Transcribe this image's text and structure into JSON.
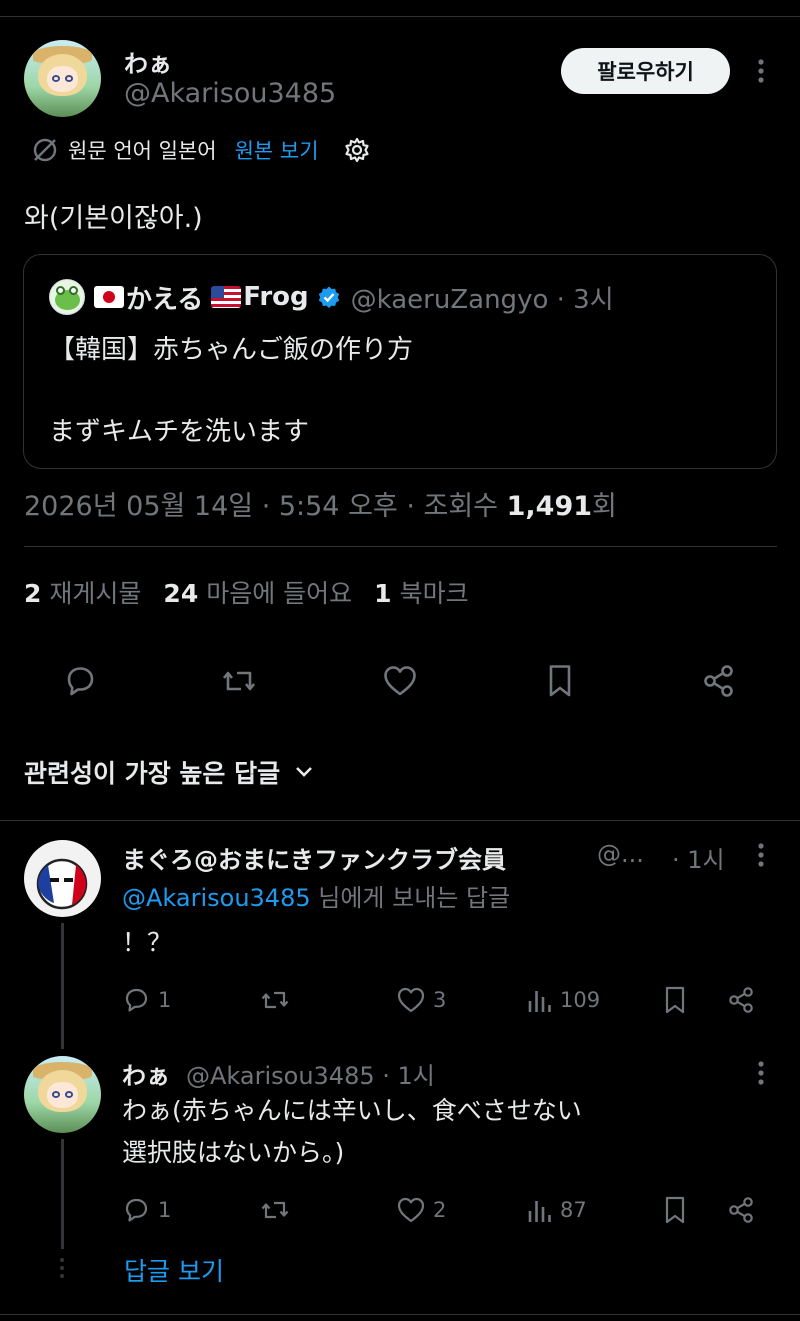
{
  "post": {
    "author_name": "わぁ",
    "author_handle": "@Akarisou3485",
    "follow_label": "팔로우하기",
    "translate_label": "원문 언어 일본어",
    "show_original_label": "원본 보기",
    "text": "와(기본이잖아.)",
    "quote": {
      "flag_left": "🇯🇵",
      "name": "かえる",
      "flag_right": "🇺🇸",
      "name_suffix": "Frog",
      "handle_time": "@kaeruZangyo · 3시",
      "line1": "【韓国】赤ちゃんご飯の作り方",
      "line2": "まずキムチを洗います"
    },
    "meta_prefix": "2026년 05월 14일 · 5:54 오후 · 조회수 ",
    "views": "1,491",
    "meta_suffix": "회",
    "stats": {
      "reposts_count": "2",
      "reposts_label": "재게시물",
      "likes_count": "24",
      "likes_label": "마음에 들어요",
      "bookmarks_count": "1",
      "bookmarks_label": "북마크"
    }
  },
  "sort_label": "관련성이 가장 높은 답글",
  "replies": [
    {
      "name": "まぐろ@おまにきファンクラブ会員",
      "handle": "@...",
      "time": "· 1시",
      "to_mention": "@Akarisou3485",
      "to_suffix": " 님에게 보내는 답글",
      "text": "！？",
      "replies": "1",
      "reposts": "",
      "likes": "3",
      "views": "109"
    },
    {
      "name": "わぁ",
      "handle": "@Akarisou3485 · 1시",
      "text_line1": "わぁ(赤ちゃんには辛いし、食べさせない",
      "text_line2": "選択肢はないから。)",
      "replies": "1",
      "reposts": "",
      "likes": "2",
      "views": "87"
    }
  ],
  "view_replies_label": "답글 보기",
  "colors": {
    "accent": "#1d9bf0",
    "background": "#000000",
    "muted": "#71767b"
  }
}
